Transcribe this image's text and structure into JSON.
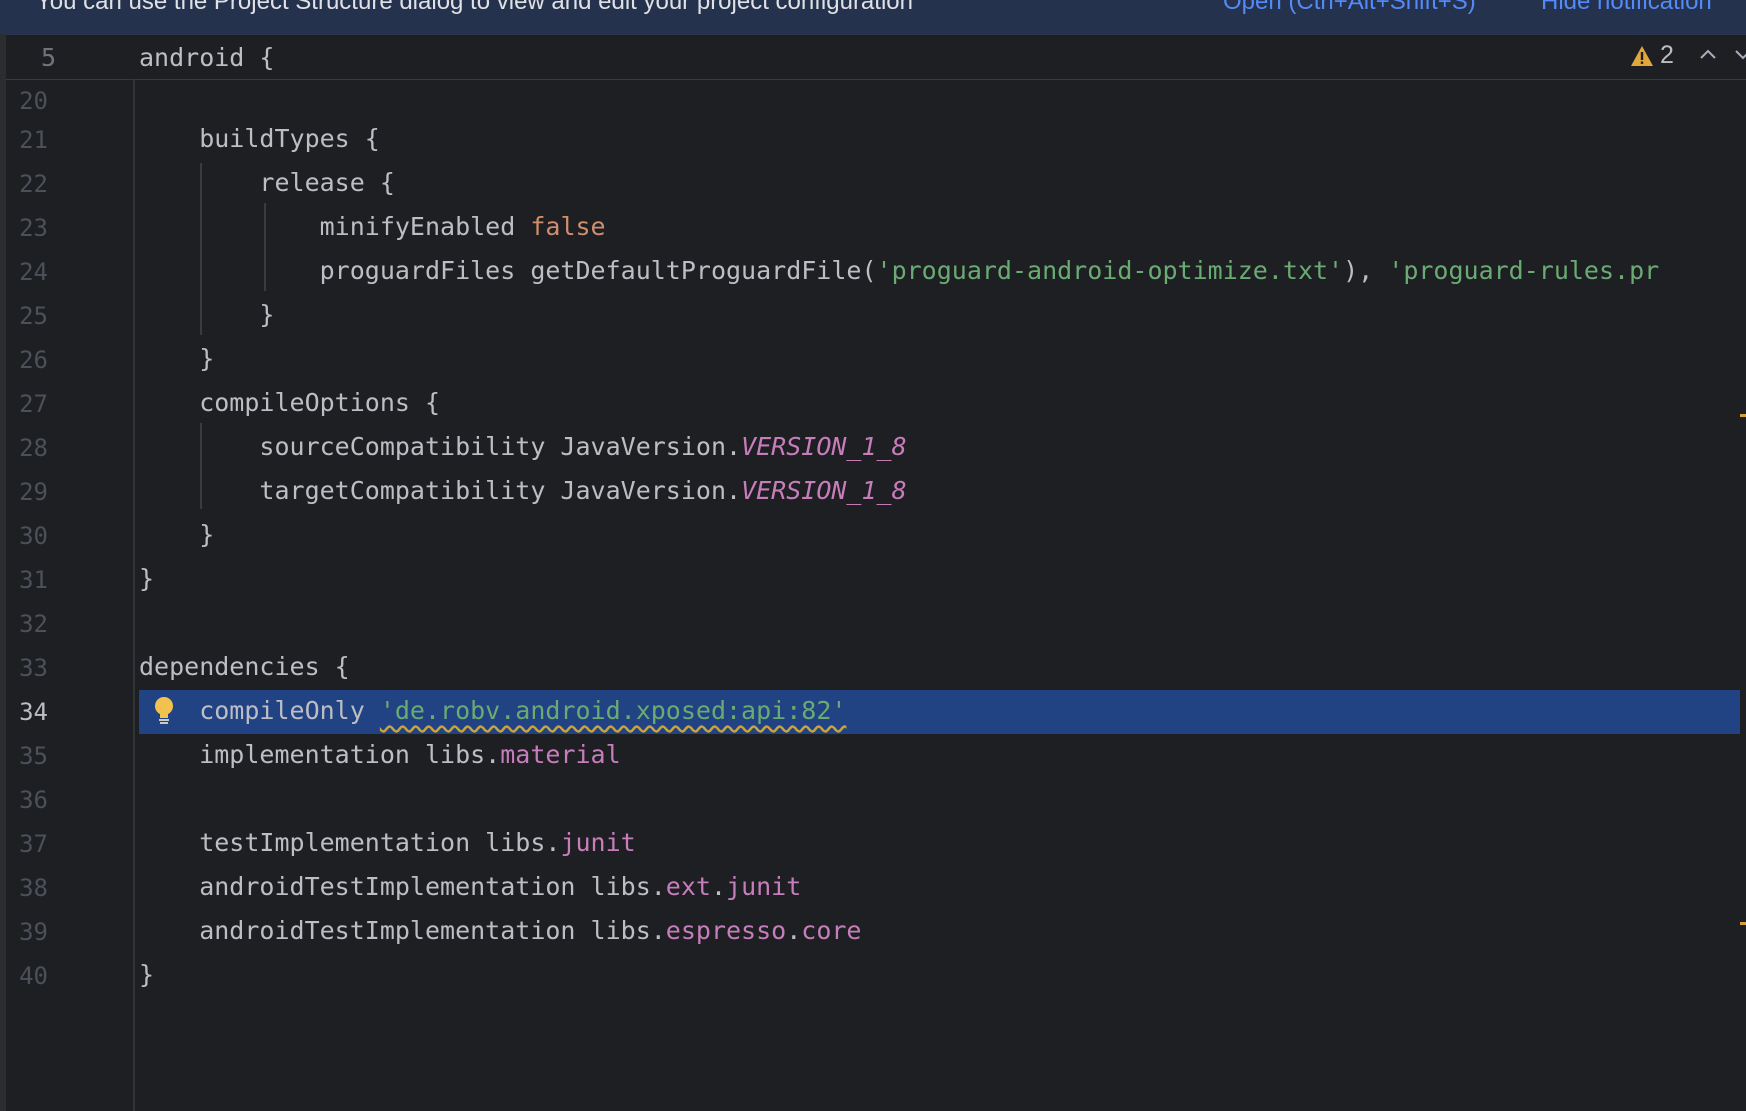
{
  "notification": {
    "message": "You can use the Project Structure dialog to view and edit your project configuration",
    "open_link": "Open (Ctrl+Alt+Shift+S)",
    "hide_link": "Hide notification"
  },
  "sticky": {
    "line": "5",
    "code": "android {",
    "warning_count": "2"
  },
  "lines": [
    {
      "n": "20"
    },
    {
      "n": "21",
      "text": "    buildTypes {"
    },
    {
      "n": "22",
      "text": "        release {"
    },
    {
      "n": "23",
      "text": "            minifyEnabled ",
      "kw": "false"
    },
    {
      "n": "24",
      "text": "            proguardFiles getDefaultProguardFile(",
      "s1": "'proguard-android-optimize.txt'",
      "t2": "), ",
      "s2": "'proguard-rules.pr"
    },
    {
      "n": "25",
      "text": "        }"
    },
    {
      "n": "26",
      "text": "    }"
    },
    {
      "n": "27",
      "text": "    compileOptions {"
    },
    {
      "n": "28",
      "text": "        sourceCompatibility JavaVersion.",
      "field": "VERSION_1_8"
    },
    {
      "n": "29",
      "text": "        targetCompatibility JavaVersion.",
      "field": "VERSION_1_8"
    },
    {
      "n": "30",
      "text": "    }"
    },
    {
      "n": "31",
      "text": "}"
    },
    {
      "n": "32"
    },
    {
      "n": "33",
      "text": "dependencies {"
    },
    {
      "n": "34",
      "text": "    compileOnly ",
      "str": "'de.robv.android.xposed:api:82'"
    },
    {
      "n": "35",
      "text": "    implementation libs.",
      "prop": "material"
    },
    {
      "n": "36"
    },
    {
      "n": "37",
      "text": "    testImplementation libs.",
      "prop": "junit"
    },
    {
      "n": "38",
      "text": "    androidTestImplementation libs.",
      "prop": "ext",
      "dot": ".",
      "prop2": "junit"
    },
    {
      "n": "39",
      "text": "    androidTestImplementation libs.",
      "prop": "espresso",
      "dot": ".",
      "prop2": "core"
    },
    {
      "n": "40",
      "text": "}"
    }
  ],
  "colors": {
    "background": "#1e1f22",
    "selection": "#214283",
    "string": "#6aab73",
    "keyword": "#cf8e6d",
    "property": "#c77dbb",
    "warning": "#d6a03b"
  }
}
